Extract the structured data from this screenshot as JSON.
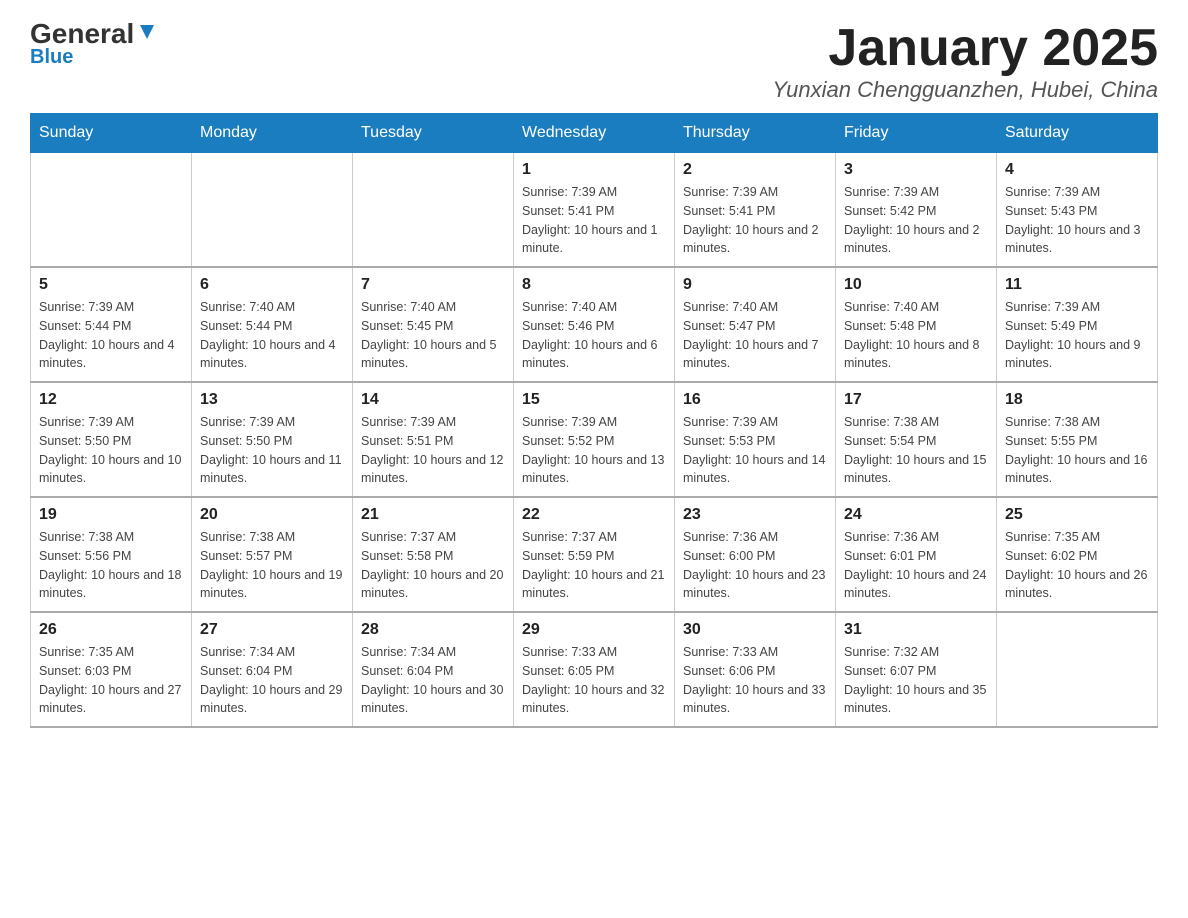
{
  "header": {
    "logo_general": "General",
    "logo_blue": "Blue",
    "main_title": "January 2025",
    "subtitle": "Yunxian Chengguanzhen, Hubei, China"
  },
  "days_of_week": [
    "Sunday",
    "Monday",
    "Tuesday",
    "Wednesday",
    "Thursday",
    "Friday",
    "Saturday"
  ],
  "weeks": [
    [
      {
        "day": "",
        "info": ""
      },
      {
        "day": "",
        "info": ""
      },
      {
        "day": "",
        "info": ""
      },
      {
        "day": "1",
        "info": "Sunrise: 7:39 AM\nSunset: 5:41 PM\nDaylight: 10 hours and 1 minute."
      },
      {
        "day": "2",
        "info": "Sunrise: 7:39 AM\nSunset: 5:41 PM\nDaylight: 10 hours and 2 minutes."
      },
      {
        "day": "3",
        "info": "Sunrise: 7:39 AM\nSunset: 5:42 PM\nDaylight: 10 hours and 2 minutes."
      },
      {
        "day": "4",
        "info": "Sunrise: 7:39 AM\nSunset: 5:43 PM\nDaylight: 10 hours and 3 minutes."
      }
    ],
    [
      {
        "day": "5",
        "info": "Sunrise: 7:39 AM\nSunset: 5:44 PM\nDaylight: 10 hours and 4 minutes."
      },
      {
        "day": "6",
        "info": "Sunrise: 7:40 AM\nSunset: 5:44 PM\nDaylight: 10 hours and 4 minutes."
      },
      {
        "day": "7",
        "info": "Sunrise: 7:40 AM\nSunset: 5:45 PM\nDaylight: 10 hours and 5 minutes."
      },
      {
        "day": "8",
        "info": "Sunrise: 7:40 AM\nSunset: 5:46 PM\nDaylight: 10 hours and 6 minutes."
      },
      {
        "day": "9",
        "info": "Sunrise: 7:40 AM\nSunset: 5:47 PM\nDaylight: 10 hours and 7 minutes."
      },
      {
        "day": "10",
        "info": "Sunrise: 7:40 AM\nSunset: 5:48 PM\nDaylight: 10 hours and 8 minutes."
      },
      {
        "day": "11",
        "info": "Sunrise: 7:39 AM\nSunset: 5:49 PM\nDaylight: 10 hours and 9 minutes."
      }
    ],
    [
      {
        "day": "12",
        "info": "Sunrise: 7:39 AM\nSunset: 5:50 PM\nDaylight: 10 hours and 10 minutes."
      },
      {
        "day": "13",
        "info": "Sunrise: 7:39 AM\nSunset: 5:50 PM\nDaylight: 10 hours and 11 minutes."
      },
      {
        "day": "14",
        "info": "Sunrise: 7:39 AM\nSunset: 5:51 PM\nDaylight: 10 hours and 12 minutes."
      },
      {
        "day": "15",
        "info": "Sunrise: 7:39 AM\nSunset: 5:52 PM\nDaylight: 10 hours and 13 minutes."
      },
      {
        "day": "16",
        "info": "Sunrise: 7:39 AM\nSunset: 5:53 PM\nDaylight: 10 hours and 14 minutes."
      },
      {
        "day": "17",
        "info": "Sunrise: 7:38 AM\nSunset: 5:54 PM\nDaylight: 10 hours and 15 minutes."
      },
      {
        "day": "18",
        "info": "Sunrise: 7:38 AM\nSunset: 5:55 PM\nDaylight: 10 hours and 16 minutes."
      }
    ],
    [
      {
        "day": "19",
        "info": "Sunrise: 7:38 AM\nSunset: 5:56 PM\nDaylight: 10 hours and 18 minutes."
      },
      {
        "day": "20",
        "info": "Sunrise: 7:38 AM\nSunset: 5:57 PM\nDaylight: 10 hours and 19 minutes."
      },
      {
        "day": "21",
        "info": "Sunrise: 7:37 AM\nSunset: 5:58 PM\nDaylight: 10 hours and 20 minutes."
      },
      {
        "day": "22",
        "info": "Sunrise: 7:37 AM\nSunset: 5:59 PM\nDaylight: 10 hours and 21 minutes."
      },
      {
        "day": "23",
        "info": "Sunrise: 7:36 AM\nSunset: 6:00 PM\nDaylight: 10 hours and 23 minutes."
      },
      {
        "day": "24",
        "info": "Sunrise: 7:36 AM\nSunset: 6:01 PM\nDaylight: 10 hours and 24 minutes."
      },
      {
        "day": "25",
        "info": "Sunrise: 7:35 AM\nSunset: 6:02 PM\nDaylight: 10 hours and 26 minutes."
      }
    ],
    [
      {
        "day": "26",
        "info": "Sunrise: 7:35 AM\nSunset: 6:03 PM\nDaylight: 10 hours and 27 minutes."
      },
      {
        "day": "27",
        "info": "Sunrise: 7:34 AM\nSunset: 6:04 PM\nDaylight: 10 hours and 29 minutes."
      },
      {
        "day": "28",
        "info": "Sunrise: 7:34 AM\nSunset: 6:04 PM\nDaylight: 10 hours and 30 minutes."
      },
      {
        "day": "29",
        "info": "Sunrise: 7:33 AM\nSunset: 6:05 PM\nDaylight: 10 hours and 32 minutes."
      },
      {
        "day": "30",
        "info": "Sunrise: 7:33 AM\nSunset: 6:06 PM\nDaylight: 10 hours and 33 minutes."
      },
      {
        "day": "31",
        "info": "Sunrise: 7:32 AM\nSunset: 6:07 PM\nDaylight: 10 hours and 35 minutes."
      },
      {
        "day": "",
        "info": ""
      }
    ]
  ]
}
